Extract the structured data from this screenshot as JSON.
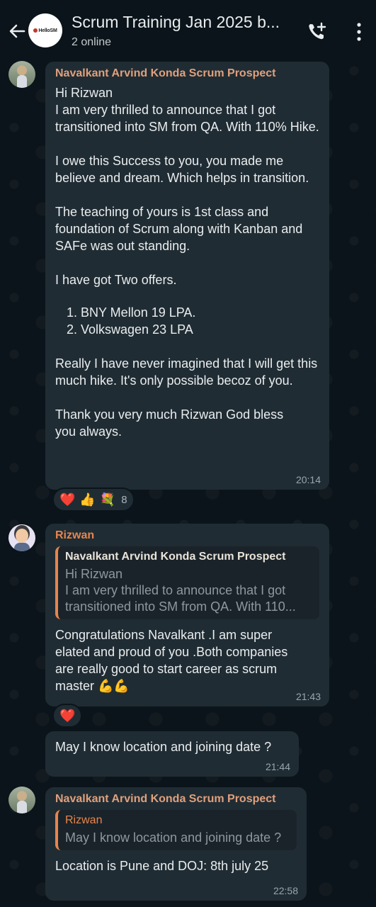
{
  "header": {
    "title": "Scrum Training Jan 2025 b...",
    "subtitle": "2 online",
    "group_logo_text": "HelloSM",
    "icons": {
      "back": "arrow-left-icon",
      "call": "add-call-icon",
      "menu": "more-vertical-icon"
    }
  },
  "messages": [
    {
      "sender": "Navalkant Arvind Konda Scrum Prospect",
      "paragraphs": [
        "Hi Rizwan\nI am very thrilled to announce that I got transitioned into SM from QA. With 110% Hike.",
        "I owe this Success to you, you made me believe and dream. Which helps in transition.",
        "The teaching of yours is 1st class and foundation of Scrum along with Kanban and SAFe was out standing.",
        "I have got Two offers."
      ],
      "list": [
        "BNY Mellon  19 LPA.",
        "Volkswagen 23 LPA"
      ],
      "closing": [
        "Really I have never imagined that I will get this much hike. It's only possible becoz of you.",
        "Thank you very much Rizwan God bless you always."
      ],
      "time": "20:14",
      "reactions": {
        "emojis": [
          "❤️",
          "👍",
          "💐"
        ],
        "count": "8"
      }
    },
    {
      "sender": "Rizwan",
      "quote": {
        "name": "Navalkant Arvind Konda Scrum Prospect",
        "line1": "Hi Rizwan",
        "line2": "I am very thrilled to announce that I got",
        "line3": "transitioned into SM from QA. With 110..."
      },
      "text": "Congratulations Navalkant .I am super elated and proud of you .Both companies are really good to start career as scrum master 💪💪",
      "time": "21:43",
      "reactions": {
        "emojis": [
          "❤️"
        ]
      }
    },
    {
      "text": "May I know location and joining date ?",
      "time": "21:44"
    },
    {
      "sender": "Navalkant Arvind Konda Scrum Prospect",
      "quote": {
        "name": "Rizwan",
        "line1": "May I know location and joining date ?"
      },
      "text": "Location is Pune and DOJ: 8th july 25",
      "time": "22:58"
    }
  ],
  "colors": {
    "background": "#0b141a",
    "bubble": "#202c33",
    "sender_navalkant": "#e0a07d",
    "sender_rizwan": "#e7854d",
    "timestamp": "#9aa5ab"
  }
}
